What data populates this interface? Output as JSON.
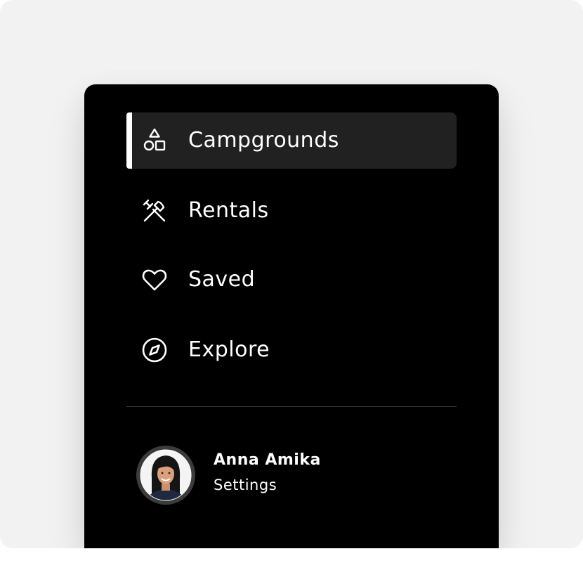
{
  "nav": {
    "items": [
      {
        "label": "Campgrounds",
        "icon": "shapes-icon",
        "active": true
      },
      {
        "label": "Rentals",
        "icon": "tools-icon",
        "active": false
      },
      {
        "label": "Saved",
        "icon": "heart-icon",
        "active": false
      },
      {
        "label": "Explore",
        "icon": "compass-icon",
        "active": false
      }
    ]
  },
  "profile": {
    "name": "Anna Amika",
    "settings_label": "Settings"
  },
  "colors": {
    "panel_background": "#000000",
    "active_item_background": "#212121",
    "active_indicator": "#ffffff",
    "text": "#ffffff",
    "divider": "#3a3a3a",
    "page_background": "#f2f2f2"
  }
}
